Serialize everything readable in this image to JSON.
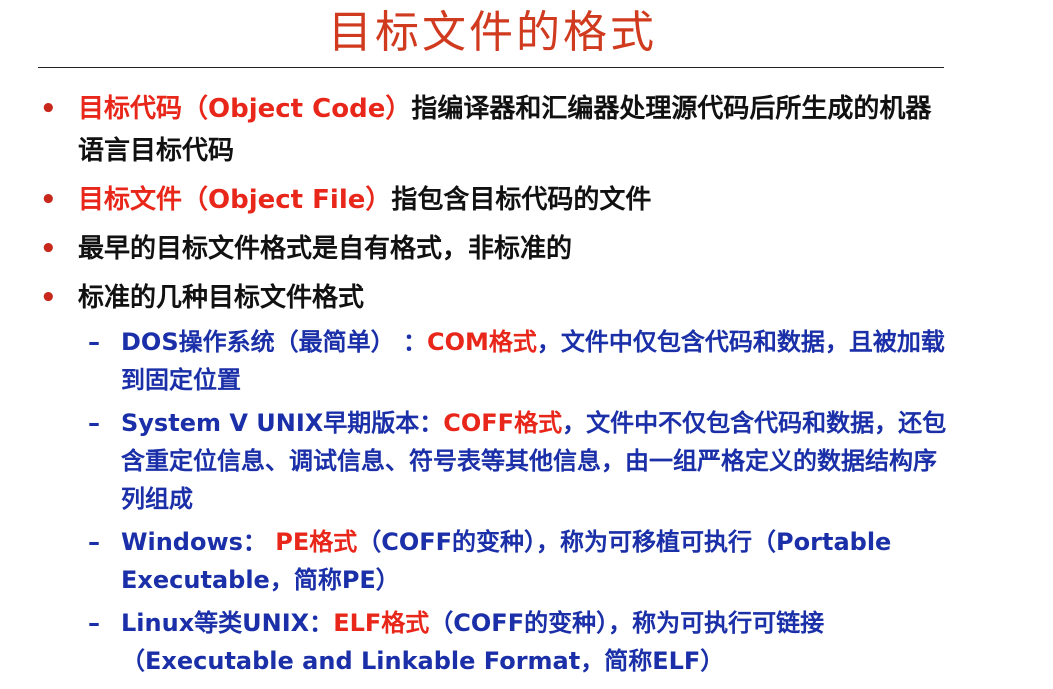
{
  "slide": {
    "title": "目标文件的格式"
  },
  "bullets": [
    {
      "marker": "•",
      "term": "目标代码（Object Code）",
      "text": "指编译器和汇编器处理源代码后所生成的机器语言目标代码"
    },
    {
      "marker": "•",
      "term": "目标文件（Object File）",
      "text": "指包含目标代码的文件"
    },
    {
      "marker": "•",
      "text": "最早的目标文件格式是自有格式，非标准的"
    },
    {
      "marker": "•",
      "text": "标准的几种目标文件格式"
    }
  ],
  "sub_bullets": [
    {
      "marker": "–",
      "before": "DOS操作系统（最简单） ：",
      "highlight": "COM格式",
      "after": "，文件中仅包含代码和数据，且被加载到固定位置"
    },
    {
      "marker": "–",
      "before": "System V UNIX早期版本：",
      "highlight": "COFF格式",
      "after": "，文件中不仅包含代码和数据，还包含重定位信息、调试信息、符号表等其他信息，由一组严格定义的数据结构序列组成"
    },
    {
      "marker": "–",
      "before": "Windows： ",
      "highlight": "PE格式",
      "after": "（COFF的变种），称为可移植可执行（Portable Executable，简称PE）"
    },
    {
      "marker": "–",
      "before": "Linux等类UNIX：",
      "highlight": "ELF格式",
      "after": "（COFF的变种），称为可执行可链接（Executable and Linkable Format，简称ELF）"
    }
  ],
  "colors": {
    "title": "#d03a1e",
    "term_red": "#e8261a",
    "body_black": "#111111",
    "sub_blue": "#1a2fa8"
  }
}
